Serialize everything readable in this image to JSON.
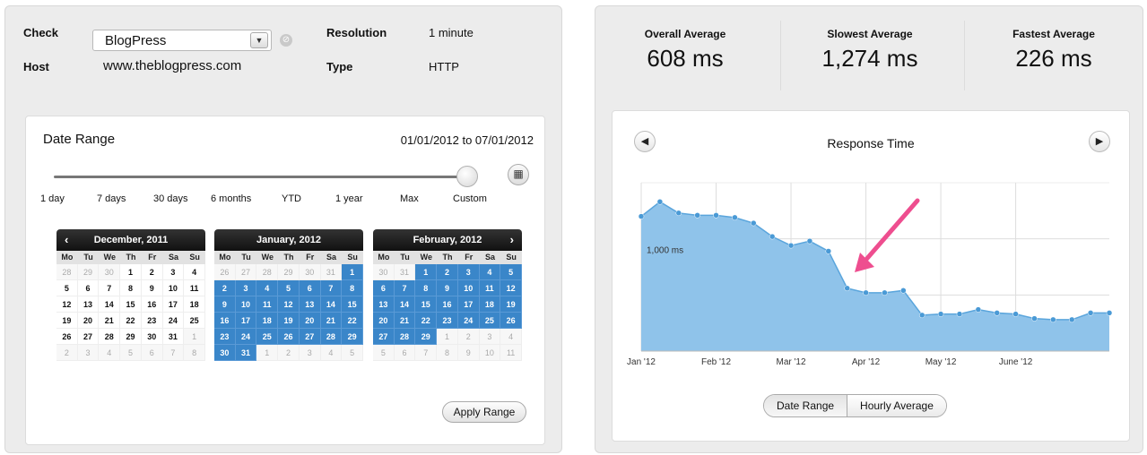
{
  "check": {
    "label": "Check",
    "value": "BlogPress",
    "host_label": "Host",
    "host_value": "www.theblogpress.com",
    "resolution_label": "Resolution",
    "resolution_value": "1 minute",
    "type_label": "Type",
    "type_value": "HTTP"
  },
  "date_range": {
    "title": "Date Range",
    "range_text": "01/01/2012 to 07/01/2012",
    "options": [
      "1 day",
      "7 days",
      "30 days",
      "6 months",
      "YTD",
      "1 year",
      "Max",
      "Custom"
    ],
    "selected_option": "Custom",
    "apply_label": "Apply Range",
    "dow": [
      "Mo",
      "Tu",
      "We",
      "Th",
      "Fr",
      "Sa",
      "Su"
    ],
    "calendars": [
      {
        "title": "December, 2011",
        "prev": "‹",
        "next": "",
        "days": [
          [
            "28",
            "o"
          ],
          [
            "29",
            "o"
          ],
          [
            "30",
            "o"
          ],
          [
            "1",
            ""
          ],
          [
            "2",
            ""
          ],
          [
            "3",
            ""
          ],
          [
            "4",
            ""
          ],
          [
            "5",
            ""
          ],
          [
            "6",
            ""
          ],
          [
            "7",
            ""
          ],
          [
            "8",
            ""
          ],
          [
            "9",
            ""
          ],
          [
            "10",
            ""
          ],
          [
            "11",
            ""
          ],
          [
            "12",
            ""
          ],
          [
            "13",
            ""
          ],
          [
            "14",
            ""
          ],
          [
            "15",
            ""
          ],
          [
            "16",
            ""
          ],
          [
            "17",
            ""
          ],
          [
            "18",
            ""
          ],
          [
            "19",
            ""
          ],
          [
            "20",
            ""
          ],
          [
            "21",
            ""
          ],
          [
            "22",
            ""
          ],
          [
            "23",
            ""
          ],
          [
            "24",
            ""
          ],
          [
            "25",
            ""
          ],
          [
            "26",
            ""
          ],
          [
            "27",
            ""
          ],
          [
            "28",
            ""
          ],
          [
            "29",
            ""
          ],
          [
            "30",
            ""
          ],
          [
            "31",
            ""
          ],
          [
            "1",
            "o"
          ],
          [
            "2",
            "o"
          ],
          [
            "3",
            "o"
          ],
          [
            "4",
            "o"
          ],
          [
            "5",
            "o"
          ],
          [
            "6",
            "o"
          ],
          [
            "7",
            "o"
          ],
          [
            "8",
            "o"
          ]
        ]
      },
      {
        "title": "January, 2012",
        "prev": "",
        "next": "",
        "days": [
          [
            "26",
            "o"
          ],
          [
            "27",
            "o"
          ],
          [
            "28",
            "o"
          ],
          [
            "29",
            "o"
          ],
          [
            "30",
            "o"
          ],
          [
            "31",
            "o"
          ],
          [
            "1",
            "s"
          ],
          [
            "2",
            "s"
          ],
          [
            "3",
            "s"
          ],
          [
            "4",
            "s"
          ],
          [
            "5",
            "s"
          ],
          [
            "6",
            "s"
          ],
          [
            "7",
            "s"
          ],
          [
            "8",
            "s"
          ],
          [
            "9",
            "s"
          ],
          [
            "10",
            "s"
          ],
          [
            "11",
            "s"
          ],
          [
            "12",
            "s"
          ],
          [
            "13",
            "s"
          ],
          [
            "14",
            "s"
          ],
          [
            "15",
            "s"
          ],
          [
            "16",
            "s"
          ],
          [
            "17",
            "s"
          ],
          [
            "18",
            "s"
          ],
          [
            "19",
            "s"
          ],
          [
            "20",
            "s"
          ],
          [
            "21",
            "s"
          ],
          [
            "22",
            "s"
          ],
          [
            "23",
            "s"
          ],
          [
            "24",
            "s"
          ],
          [
            "25",
            "s"
          ],
          [
            "26",
            "s"
          ],
          [
            "27",
            "s"
          ],
          [
            "28",
            "s"
          ],
          [
            "29",
            "s"
          ],
          [
            "30",
            "s"
          ],
          [
            "31",
            "s"
          ],
          [
            "1",
            "o"
          ],
          [
            "2",
            "o"
          ],
          [
            "3",
            "o"
          ],
          [
            "4",
            "o"
          ],
          [
            "5",
            "o"
          ]
        ]
      },
      {
        "title": "February, 2012",
        "prev": "",
        "next": "›",
        "days": [
          [
            "30",
            "o"
          ],
          [
            "31",
            "o"
          ],
          [
            "1",
            "s"
          ],
          [
            "2",
            "s"
          ],
          [
            "3",
            "s"
          ],
          [
            "4",
            "s"
          ],
          [
            "5",
            "s"
          ],
          [
            "6",
            "s"
          ],
          [
            "7",
            "s"
          ],
          [
            "8",
            "s"
          ],
          [
            "9",
            "s"
          ],
          [
            "10",
            "s"
          ],
          [
            "11",
            "s"
          ],
          [
            "12",
            "s"
          ],
          [
            "13",
            "s"
          ],
          [
            "14",
            "s"
          ],
          [
            "15",
            "s"
          ],
          [
            "16",
            "s"
          ],
          [
            "17",
            "s"
          ],
          [
            "18",
            "s"
          ],
          [
            "19",
            "s"
          ],
          [
            "20",
            "s"
          ],
          [
            "21",
            "s"
          ],
          [
            "22",
            "s"
          ],
          [
            "23",
            "s"
          ],
          [
            "24",
            "s"
          ],
          [
            "25",
            "s"
          ],
          [
            "26",
            "s"
          ],
          [
            "27",
            "s"
          ],
          [
            "28",
            "s"
          ],
          [
            "29",
            "s"
          ],
          [
            "1",
            "o"
          ],
          [
            "2",
            "o"
          ],
          [
            "3",
            "o"
          ],
          [
            "4",
            "o"
          ],
          [
            "5",
            "o"
          ],
          [
            "6",
            "o"
          ],
          [
            "7",
            "o"
          ],
          [
            "8",
            "o"
          ],
          [
            "9",
            "o"
          ],
          [
            "10",
            "o"
          ],
          [
            "11",
            "o"
          ]
        ]
      }
    ]
  },
  "stats": [
    {
      "title": "Overall Average",
      "value": "608 ms"
    },
    {
      "title": "Slowest Average",
      "value": "1,274 ms"
    },
    {
      "title": "Fastest Average",
      "value": "226 ms"
    }
  ],
  "chart_title": "Response Time",
  "prev_icon": "left-arrow-icon",
  "next_icon": "right-arrow-icon",
  "toggle": {
    "active": "Date Range",
    "inactive": "Hourly Average"
  },
  "colors": {
    "fill": "#8fc3ea",
    "line": "#5aa5dc",
    "point": "#4a9ad6",
    "arrow": "#ee4e8f",
    "selected_day": "#3a86c9"
  },
  "chart_data": {
    "type": "area",
    "title": "Response Time",
    "x_ticks": [
      "Jan '12",
      "Feb '12",
      "Mar '12",
      "Apr '12",
      "May '12",
      "June '12"
    ],
    "y_annotation": "1,000 ms",
    "ylim": [
      0,
      1500
    ],
    "grid": true,
    "x": [
      0,
      0.25,
      0.5,
      0.75,
      1,
      1.25,
      1.5,
      1.75,
      2,
      2.25,
      2.5,
      2.75,
      3,
      3.25,
      3.5,
      3.75,
      4,
      4.25,
      4.5,
      4.75,
      5,
      5.25,
      5.5,
      5.75,
      6,
      6.25
    ],
    "values": [
      1200,
      1330,
      1230,
      1210,
      1210,
      1190,
      1140,
      1020,
      940,
      980,
      890,
      560,
      520,
      520,
      540,
      320,
      330,
      330,
      370,
      340,
      330,
      290,
      280,
      280,
      340,
      340
    ],
    "annotation": "arrow pointing to drop"
  }
}
